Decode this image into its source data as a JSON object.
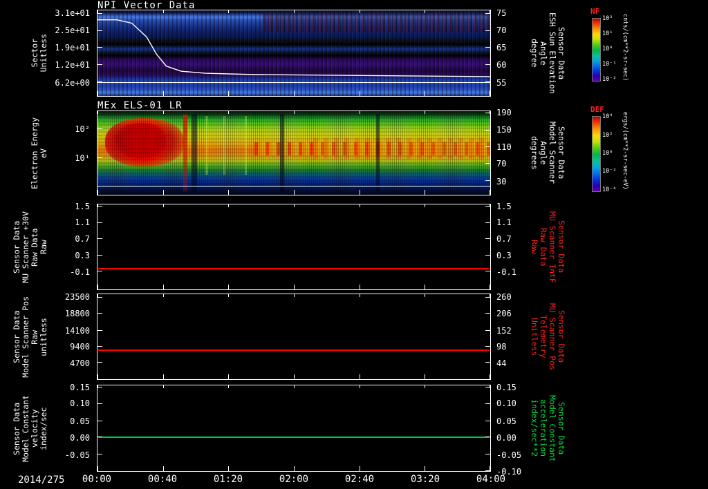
{
  "figure": {
    "date_label": "2014/275",
    "x_ticks": [
      "00:00",
      "00:40",
      "01:20",
      "02:00",
      "02:40",
      "03:20",
      "04:00"
    ]
  },
  "colors": {
    "axis": "#ffffff",
    "red_label": "#ff2020",
    "green_label": "#00e040",
    "red_line": "#ff0000",
    "green_line": "#00cc44"
  },
  "colorbars": [
    {
      "title": "NF",
      "units": "cnts/(cm**2-sr-sec)",
      "ticks": [
        {
          "t": "10²",
          "p": 2
        },
        {
          "t": "10¹",
          "p": 26
        },
        {
          "t": "10⁰",
          "p": 50
        },
        {
          "t": "10⁻¹",
          "p": 74
        },
        {
          "t": "10⁻²",
          "p": 98
        }
      ]
    },
    {
      "title": "DEF",
      "units": "ergs/(cm**2-sr-sec-eV)",
      "ticks": [
        {
          "t": "10⁴",
          "p": 2
        },
        {
          "t": "10²",
          "p": 26
        },
        {
          "t": "10⁰",
          "p": 50
        },
        {
          "t": "10⁻²",
          "p": 74
        },
        {
          "t": "10⁻⁴",
          "p": 98
        }
      ]
    }
  ],
  "panels": [
    {
      "title": "NPI Vector Data",
      "left_label": "Sector\nUnitless",
      "right_label": "Sensor Data\nESH Sun Elevation\nAngle\ndegree",
      "right_color": "#ffffff",
      "left_ticks": [
        {
          "t": "3.1e+01",
          "p": 3
        },
        {
          "t": "2.5e+01",
          "p": 23
        },
        {
          "t": "1.9e+01",
          "p": 43
        },
        {
          "t": "1.2e+01",
          "p": 63
        },
        {
          "t": "6.2e+00",
          "p": 83
        }
      ],
      "right_ticks": [
        {
          "t": "75",
          "p": 3
        },
        {
          "t": "70",
          "p": 23
        },
        {
          "t": "65",
          "p": 43
        },
        {
          "t": "60",
          "p": 63
        },
        {
          "t": "55",
          "p": 83
        }
      ],
      "hline_p": 84,
      "overlay": {
        "x_hours": [
          0,
          0.2,
          0.35,
          0.5,
          0.6,
          0.7,
          0.85,
          1.1,
          1.6,
          4.0
        ],
        "values": [
          73,
          73,
          72,
          68,
          63,
          59.5,
          58,
          57.4,
          57,
          56.4
        ],
        "v0": 75,
        "p0": 3,
        "k": 4,
        "x_max": 4
      }
    },
    {
      "title": "MEx ELS-01 LR",
      "left_label": "Electron Energy\neV",
      "right_label": "Sensor Data\nModel Scanner\nAngle\ndegrees",
      "right_color": "#ffffff",
      "left_ticks": [
        {
          "t": "10²",
          "p": 21
        },
        {
          "t": "10¹",
          "p": 55
        }
      ],
      "right_ticks": [
        {
          "t": "190",
          "p": 2
        },
        {
          "t": "150",
          "p": 22
        },
        {
          "t": "110",
          "p": 42
        },
        {
          "t": "70",
          "p": 62
        },
        {
          "t": "30",
          "p": 83
        }
      ],
      "hline_p": 89
    },
    {
      "left_label": "Sensor Data\nMU Scanner +30V\nRaw Data\nRaw",
      "right_label": "Sensor Data\nMU Scanner IntF\nRaw Data\nRaw",
      "right_color": "#ff2020",
      "left_ticks": [
        {
          "t": "1.5",
          "p": 2
        },
        {
          "t": "1.1",
          "p": 21
        },
        {
          "t": "0.7",
          "p": 40
        },
        {
          "t": "0.3",
          "p": 59
        },
        {
          "t": "-0.1",
          "p": 78
        }
      ],
      "right_ticks": [
        {
          "t": "1.5",
          "p": 2
        },
        {
          "t": "1.1",
          "p": 21
        },
        {
          "t": "0.7",
          "p": 40
        },
        {
          "t": "0.3",
          "p": 59
        },
        {
          "t": "-0.1",
          "p": 78
        }
      ],
      "line": {
        "value": 0.0,
        "ylim": [
          -0.5,
          1.5
        ],
        "color": "#ff0000"
      }
    },
    {
      "left_label": "Sensor Data\nModel Scanner Pos\nRaw\nunitless",
      "right_label": "Sensor Data\nMU Scanner Pos\nTelemetry\nUnitless",
      "right_color": "#ff2020",
      "left_ticks": [
        {
          "t": "23500",
          "p": 3
        },
        {
          "t": "18800",
          "p": 22
        },
        {
          "t": "14100",
          "p": 42
        },
        {
          "t": "9400",
          "p": 61
        },
        {
          "t": "4700",
          "p": 80
        }
      ],
      "right_ticks": [
        {
          "t": "260",
          "p": 3
        },
        {
          "t": "206",
          "p": 22
        },
        {
          "t": "152",
          "p": 42
        },
        {
          "t": "98",
          "p": 61
        },
        {
          "t": "44",
          "p": 80
        }
      ],
      "line": {
        "value": 8200,
        "ylim": [
          0,
          23500
        ],
        "color": "#ff0000"
      }
    },
    {
      "left_label": "Sensor Data\nModel Constant\nvelocity\nindex/sec",
      "right_label": "Sensor Data\nModel Constant\nacceleration\nindex/sec**2",
      "right_color": "#00e040",
      "left_ticks": [
        {
          "t": "0.15",
          "p": 2
        },
        {
          "t": "0.10",
          "p": 21
        },
        {
          "t": "0.05",
          "p": 41
        },
        {
          "t": "0.00",
          "p": 60
        },
        {
          "t": "-0.05",
          "p": 80
        }
      ],
      "right_ticks": [
        {
          "t": "0.15",
          "p": 2
        },
        {
          "t": "0.10",
          "p": 21
        },
        {
          "t": "0.05",
          "p": 41
        },
        {
          "t": "0.00",
          "p": 60
        },
        {
          "t": "-0.05",
          "p": 80
        },
        {
          "t": "-0.10",
          "p": 99
        }
      ],
      "line": {
        "value": 0.0,
        "ylim": [
          -0.1,
          0.15
        ],
        "color": "#00cc44"
      }
    }
  ],
  "chart_data": [
    {
      "type": "heatmap",
      "title": "NPI Vector Data",
      "xlabel": "UT time, 2014/275 00:00 to 04:00",
      "ylabel": "Sector Unitless",
      "ylim": [
        0,
        31
      ],
      "yticks": [
        31,
        25,
        19,
        12,
        6.2
      ],
      "right_axis": {
        "label": "Sensor Data ESH Sun Elevation Angle degree",
        "ticks": [
          75,
          70,
          65,
          60,
          55
        ]
      },
      "colorbar": {
        "label": "NF",
        "units": "cnts/(cm**2-sr-sec)"
      },
      "overlay_series": {
        "name": "ESH Sun Elevation Angle",
        "x_hours": [
          0,
          0.2,
          0.35,
          0.5,
          0.6,
          0.7,
          0.85,
          1.1,
          1.6,
          4.0
        ],
        "values": [
          73,
          73,
          72,
          68,
          63,
          59.5,
          58,
          57.4,
          57,
          56.4
        ]
      },
      "description": "Blue-dominated sector-time spectrogram; bright blue rows near sectors 25-27 and 1-3, black bands near sectors 14-19, purple band sectors 5-9, dark red speckle at top right, white constant line near sector 4."
    },
    {
      "type": "heatmap",
      "title": "MEx ELS-01 LR",
      "xlabel": "UT time, 2014/275 00:00 to 04:00",
      "ylabel": "Electron Energy eV",
      "yscale": "log",
      "yticks": [
        100,
        10
      ],
      "right_axis": {
        "label": "Sensor Data Model Scanner Angle degrees",
        "ticks": [
          190,
          150,
          110,
          70,
          30
        ]
      },
      "colorbar": {
        "label": "DEF",
        "units": "ergs/(cm**2-sr-sec-eV)"
      },
      "description": "Intense red flux enhancement 10-200 eV from about 00:05 to 00:50, persistent yellow-orange band near 20-50 eV for the rest of the interval, green at 100-300 eV, blue/dark below 10 eV, white constant line near the bottom."
    },
    {
      "type": "line",
      "series": [
        {
          "name": "Sensor Data MU Scanner +30V Raw Data Raw",
          "color": "#ff0000",
          "x_hours": [
            0,
            4
          ],
          "values": [
            0.0,
            0.0
          ]
        }
      ],
      "ylim": [
        -0.5,
        1.5
      ],
      "yticks": [
        1.5,
        1.1,
        0.7,
        0.3,
        -0.1
      ],
      "right_axis": {
        "label": "Sensor Data MU Scanner IntF Raw Data Raw",
        "ticks": [
          1.5,
          1.1,
          0.7,
          0.3,
          -0.1
        ]
      }
    },
    {
      "type": "line",
      "series": [
        {
          "name": "Sensor Data Model Scanner Pos Raw unitless",
          "color": "#ff0000",
          "x_hours": [
            0,
            4
          ],
          "values": [
            8200,
            8200
          ]
        }
      ],
      "ylim": [
        0,
        23500
      ],
      "yticks": [
        23500,
        18800,
        14100,
        9400,
        4700
      ],
      "right_axis": {
        "label": "Sensor Data MU Scanner Pos Telemetry Unitless",
        "ticks": [
          260,
          206,
          152,
          98,
          44
        ]
      }
    },
    {
      "type": "line",
      "series": [
        {
          "name": "Sensor Data Model Constant velocity index/sec",
          "color": "#00cc44",
          "x_hours": [
            0,
            4
          ],
          "values": [
            0.0,
            0.0
          ]
        }
      ],
      "ylim": [
        -0.1,
        0.15
      ],
      "yticks": [
        0.15,
        0.1,
        0.05,
        0.0,
        -0.05,
        -0.1
      ],
      "right_axis": {
        "label": "Sensor Data Model Constant acceleration index/sec**2",
        "ticks": [
          0.15,
          0.1,
          0.05,
          0.0,
          -0.05,
          -0.1
        ]
      }
    }
  ]
}
